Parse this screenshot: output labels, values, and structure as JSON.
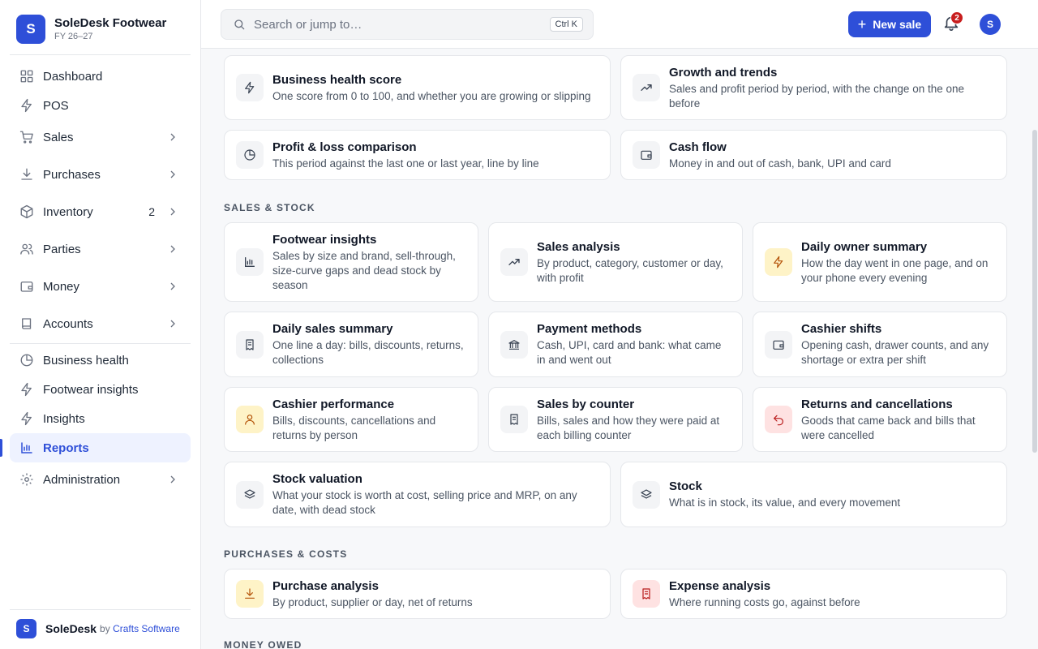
{
  "app": {
    "brand_name": "SoleDesk Footwear",
    "brand_initial": "S",
    "fiscal_year": "FY 26–27"
  },
  "sidebar": {
    "items": [
      {
        "label": "Dashboard",
        "icon": "grid-icon"
      },
      {
        "label": "POS",
        "icon": "bolt-icon"
      },
      {
        "label": "Sales",
        "icon": "cart-icon"
      },
      {
        "label": "Purchases",
        "icon": "download-icon"
      },
      {
        "label": "Inventory",
        "icon": "box-icon",
        "badge": "2"
      },
      {
        "label": "Parties",
        "icon": "users-icon"
      },
      {
        "label": "Money",
        "icon": "wallet-icon"
      },
      {
        "label": "Accounts",
        "icon": "book-icon"
      },
      {
        "label": "Business health",
        "icon": "pie-icon"
      },
      {
        "label": "Footwear insights",
        "icon": "bolt-icon"
      },
      {
        "label": "Insights",
        "icon": "bolt-icon"
      },
      {
        "label": "Reports",
        "icon": "bar-chart-icon"
      },
      {
        "label": "Administration",
        "icon": "gear-icon"
      }
    ],
    "active": "Reports"
  },
  "footer": {
    "initial": "S",
    "product": "SoleDesk",
    "by": "by",
    "vendor": "Crafts Software"
  },
  "header": {
    "search_placeholder": "Search or jump to…",
    "search_shortcut": "Ctrl K",
    "new_sale_label": "New sale",
    "notification_count": "2",
    "avatar_initial": "S"
  },
  "sections": {
    "sales_stock": "SALES & STOCK",
    "purchases_costs": "PURCHASES & COSTS",
    "money_owed": "MONEY OWED"
  },
  "cards": {
    "business_health": {
      "title": "Business health score",
      "desc": "One score from 0 to 100, and whether you are growing or slipping",
      "icon": "bolt-icon"
    },
    "growth": {
      "title": "Growth and trends",
      "desc": "Sales and profit period by period, with the change on the one before",
      "icon": "trend-up-icon"
    },
    "pnl": {
      "title": "Profit & loss comparison",
      "desc": "This period against the last one or last year, line by line",
      "icon": "pie-icon"
    },
    "cash_flow": {
      "title": "Cash flow",
      "desc": "Money in and out of cash, bank, UPI and card",
      "icon": "wallet-icon"
    },
    "footwear": {
      "title": "Footwear insights",
      "desc": "Sales by size and brand, sell-through, size-curve gaps and dead stock by season",
      "icon": "bar-chart-icon"
    },
    "sales_analysis": {
      "title": "Sales analysis",
      "desc": "By product, category, customer or day, with profit",
      "icon": "trend-up-icon"
    },
    "owner_summary": {
      "title": "Daily owner summary",
      "desc": "How the day went in one page, and on your phone every evening",
      "icon": "bolt-icon"
    },
    "daily_sales": {
      "title": "Daily sales summary",
      "desc": "One line a day: bills, discounts, returns, collections",
      "icon": "receipt-icon"
    },
    "payment_methods": {
      "title": "Payment methods",
      "desc": "Cash, UPI, card and bank: what came in and went out",
      "icon": "bank-icon"
    },
    "cashier_shifts": {
      "title": "Cashier shifts",
      "desc": "Opening cash, drawer counts, and any shortage or extra per shift",
      "icon": "wallet-icon"
    },
    "cashier_perf": {
      "title": "Cashier performance",
      "desc": "Bills, discounts, cancellations and returns by person",
      "icon": "user-icon"
    },
    "sales_counter": {
      "title": "Sales by counter",
      "desc": "Bills, sales and how they were paid at each billing counter",
      "icon": "receipt-icon"
    },
    "returns": {
      "title": "Returns and cancellations",
      "desc": "Goods that came back and bills that were cancelled",
      "icon": "undo-icon"
    },
    "stock_valuation": {
      "title": "Stock valuation",
      "desc": "What your stock is worth at cost, selling price and MRP, on any date, with dead stock",
      "icon": "layers-icon"
    },
    "stock": {
      "title": "Stock",
      "desc": "What is in stock, its value, and every movement",
      "icon": "layers-icon"
    },
    "purchase_analysis": {
      "title": "Purchase analysis",
      "desc": "By product, supplier or day, net of returns",
      "icon": "download-icon"
    },
    "expense_analysis": {
      "title": "Expense analysis",
      "desc": "Where running costs go, against before",
      "icon": "receipt-icon"
    }
  }
}
